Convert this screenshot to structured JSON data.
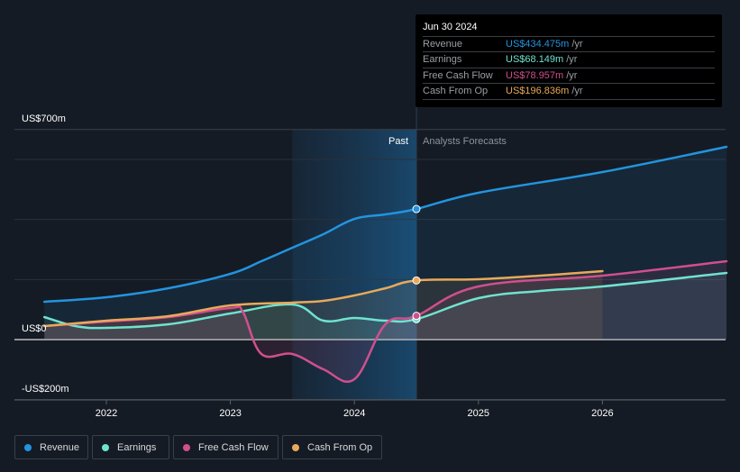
{
  "tooltip": {
    "date": "Jun 30 2024",
    "rows": [
      {
        "label": "Revenue",
        "value": "US$434.475m",
        "unit": "/yr",
        "color": "#2394df"
      },
      {
        "label": "Earnings",
        "value": "US$68.149m",
        "unit": "/yr",
        "color": "#6fe3cf"
      },
      {
        "label": "Free Cash Flow",
        "value": "US$78.957m",
        "unit": "/yr",
        "color": "#d04f8e"
      },
      {
        "label": "Cash From Op",
        "value": "US$196.836m",
        "unit": "/yr",
        "color": "#e8a95b"
      }
    ]
  },
  "legend": [
    {
      "label": "Revenue",
      "color": "#2394df"
    },
    {
      "label": "Earnings",
      "color": "#6fe3cf"
    },
    {
      "label": "Free Cash Flow",
      "color": "#d04f8e"
    },
    {
      "label": "Cash From Op",
      "color": "#e8a95b"
    }
  ],
  "chart_data": {
    "type": "line",
    "title": "",
    "xlabel": "",
    "ylabel": "",
    "y_tick_labels": [
      "US$700m",
      "US$0",
      "-US$200m"
    ],
    "y_ticks": [
      700,
      0,
      -200
    ],
    "gridlines": [
      700,
      600,
      400,
      200,
      0,
      -200
    ],
    "ylim": [
      -200,
      700
    ],
    "xlim": [
      2021.5,
      2027.0
    ],
    "x_ticks": [
      2022,
      2023,
      2024,
      2025,
      2026
    ],
    "x_tick_labels": [
      "2022",
      "2023",
      "2024",
      "2025",
      "2026"
    ],
    "grid": true,
    "legend_position": "bottom-left",
    "regions": {
      "past_label": "Past",
      "forecast_label": "Analysts Forecasts",
      "past_start": 2023.5,
      "divider": 2024.5,
      "forecast_band_end": 2026.0
    },
    "highlight_x": 2024.5,
    "series": [
      {
        "name": "Revenue",
        "color": "#2394df",
        "x": [
          2021.5,
          2022.0,
          2022.5,
          2023.0,
          2023.25,
          2023.5,
          2023.75,
          2024.0,
          2024.25,
          2024.5,
          2025.0,
          2026.0,
          2027.0
        ],
        "values": [
          126,
          141,
          171,
          219,
          261,
          306,
          351,
          402,
          417,
          435,
          489,
          558,
          642
        ]
      },
      {
        "name": "Earnings",
        "color": "#6fe3cf",
        "x": [
          2021.5,
          2021.75,
          2022.0,
          2022.5,
          2023.0,
          2023.5,
          2023.75,
          2024.0,
          2024.25,
          2024.5,
          2025.0,
          2025.5,
          2026.0,
          2027.0
        ],
        "values": [
          75,
          45,
          39,
          51,
          87,
          117,
          63,
          72,
          63,
          68,
          138,
          162,
          177,
          222
        ]
      },
      {
        "name": "Free Cash Flow",
        "color": "#d04f8e",
        "x": [
          2021.5,
          2022.0,
          2022.5,
          2023.0,
          2023.1,
          2023.25,
          2023.5,
          2023.75,
          2024.0,
          2024.25,
          2024.5,
          2025.0,
          2026.0,
          2027.0
        ],
        "values": [
          45,
          60,
          75,
          105,
          93,
          -48,
          -48,
          -99,
          -132,
          51,
          79,
          177,
          213,
          261
        ]
      },
      {
        "name": "Cash From Op",
        "color": "#e8a95b",
        "x": [
          2021.5,
          2022.0,
          2022.5,
          2023.0,
          2023.5,
          2023.75,
          2024.0,
          2024.25,
          2024.5,
          2025.0,
          2025.5,
          2026.0
        ],
        "values": [
          45,
          63,
          78,
          114,
          123,
          129,
          147,
          171,
          197,
          201,
          213,
          228
        ]
      }
    ]
  }
}
